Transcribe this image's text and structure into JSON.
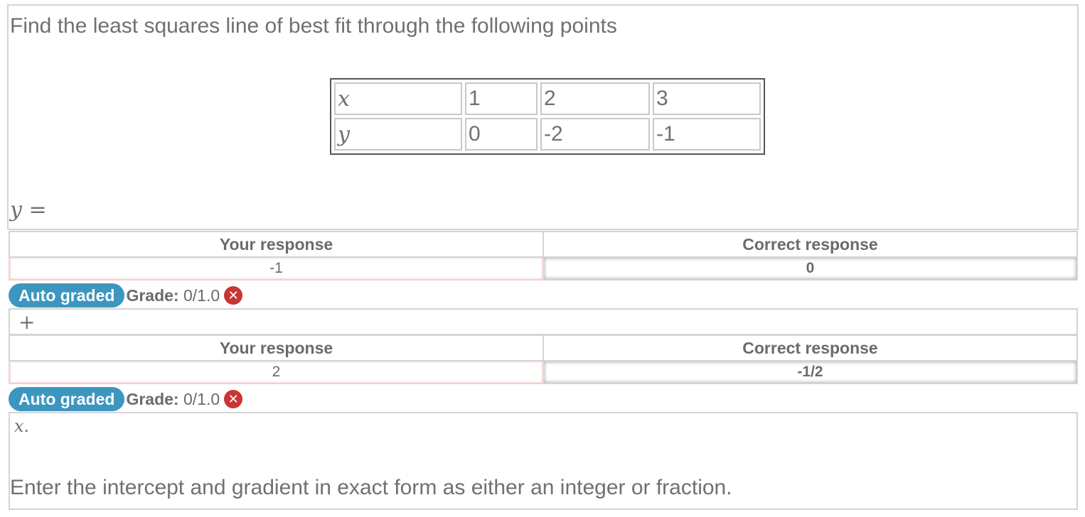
{
  "question": {
    "prompt": "Find the least squares line of best fit through the following points",
    "table": {
      "row_x": {
        "label": "x",
        "values": [
          "1",
          "2",
          "3"
        ]
      },
      "row_y": {
        "label": "y",
        "values": [
          "0",
          "-2",
          "-1"
        ]
      }
    },
    "answer_prefix": "y ="
  },
  "part1": {
    "your_header": "Your response",
    "correct_header": "Correct response",
    "your_value": "-1",
    "correct_value": "0",
    "badge": "Auto graded",
    "grade_label": "Grade:",
    "grade_value": "0/1.0",
    "status_icon": "incorrect-icon"
  },
  "connector": "+",
  "part2": {
    "your_header": "Your response",
    "correct_header": "Correct response",
    "your_value": "2",
    "correct_value": "-1/2",
    "badge": "Auto graded",
    "grade_label": "Grade:",
    "grade_value": "0/1.0",
    "status_icon": "incorrect-icon"
  },
  "suffix": "x.",
  "instruction": "Enter the intercept and gradient in exact form as either an integer or fraction.",
  "colors": {
    "badge": "#3d96bf",
    "incorrect": "#c93434",
    "text": "#6b6b6b",
    "border": "#d4d4d4"
  }
}
